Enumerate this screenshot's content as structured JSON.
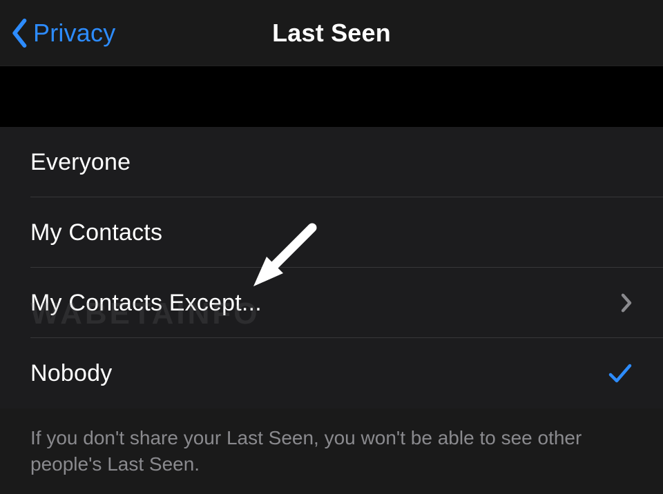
{
  "nav": {
    "back_label": "Privacy",
    "title": "Last Seen"
  },
  "options": {
    "everyone": "Everyone",
    "my_contacts": "My Contacts",
    "my_contacts_except": "My Contacts Except...",
    "nobody": "Nobody"
  },
  "selected": "nobody",
  "footer": "If you don't share your Last Seen, you won't be able to see other people's Last Seen.",
  "watermark": "WABETAINFO",
  "colors": {
    "accent_blue": "#2d8cff",
    "check_blue": "#2d8cff",
    "cell_bg": "#1c1c1e",
    "footer_text": "#8a8a8e"
  }
}
